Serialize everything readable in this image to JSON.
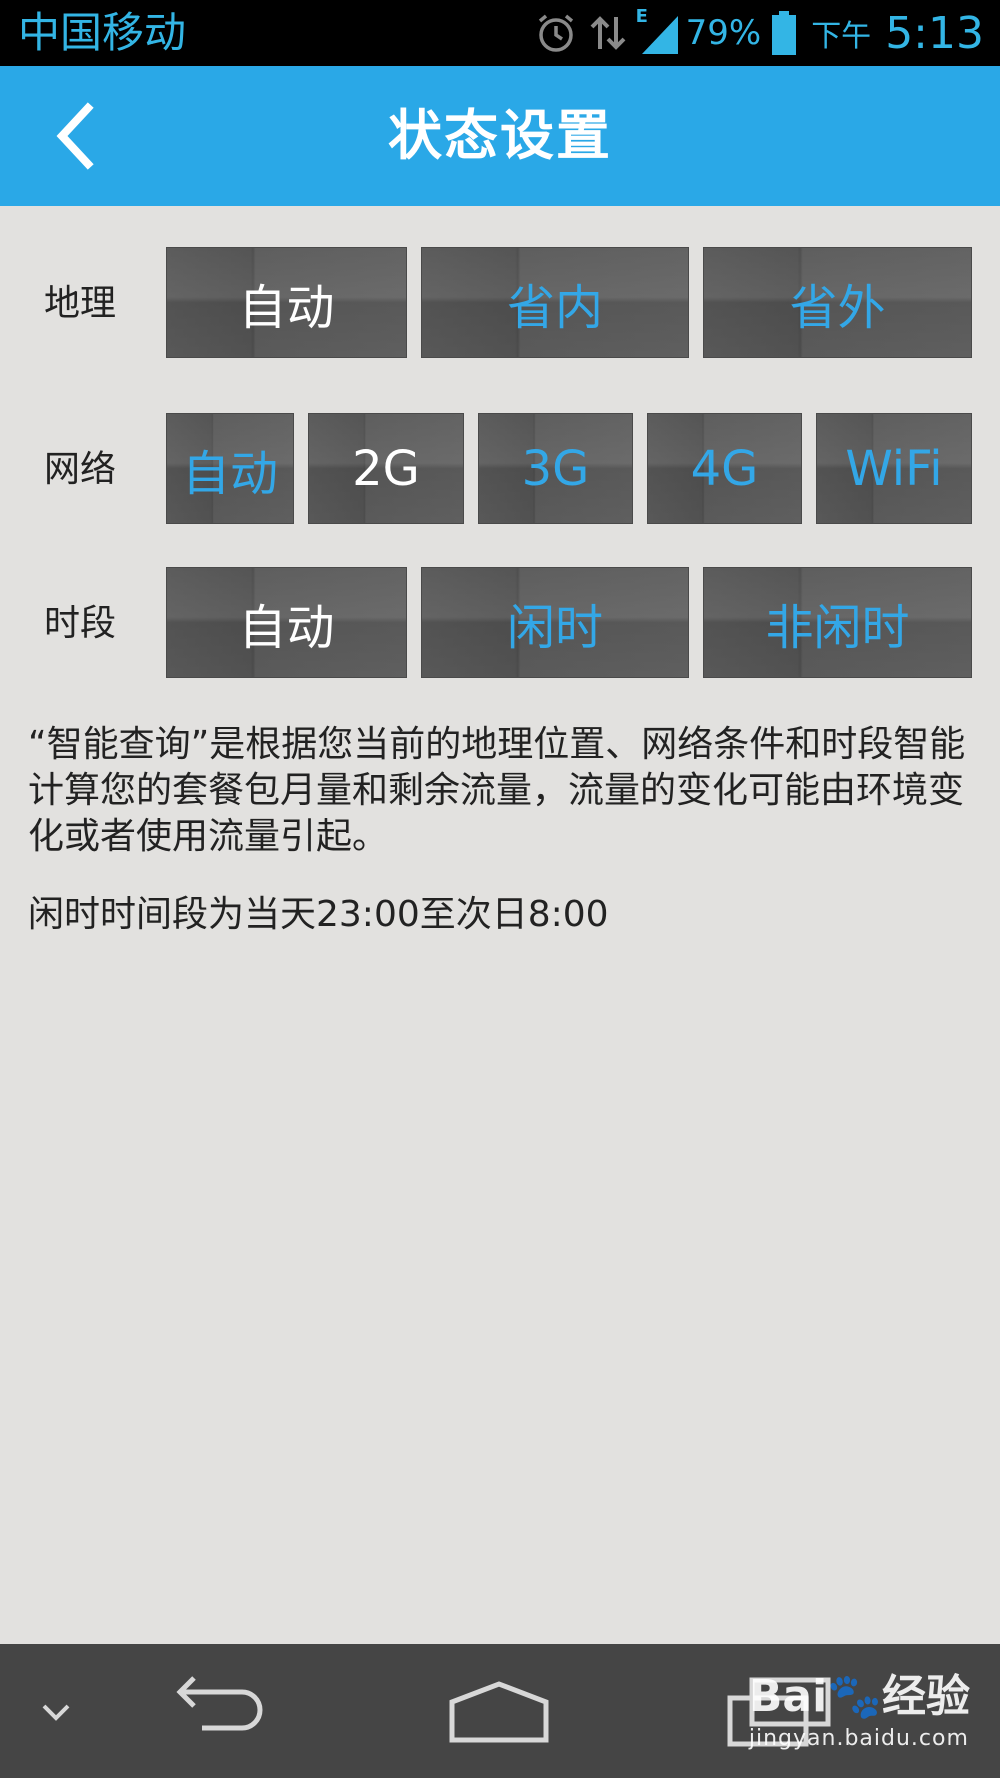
{
  "status_bar": {
    "carrier": "中国移动",
    "battery_percent": "79%",
    "ampm": "下午",
    "time": "5:13",
    "icons": [
      "alarm-icon",
      "data-arrows-icon",
      "signal-icon",
      "battery-icon"
    ],
    "network_badge": "E"
  },
  "header": {
    "title": "状态设置",
    "back_icon": "chevron-left-icon"
  },
  "rows": {
    "geo": {
      "label": "地理",
      "options": [
        "自动",
        "省内",
        "省外"
      ],
      "selected": "自动"
    },
    "network": {
      "label": "网络",
      "options": [
        "自动",
        "2G",
        "3G",
        "4G",
        "WiFi"
      ],
      "selected": "2G"
    },
    "period": {
      "label": "时段",
      "options": [
        "自动",
        "闲时",
        "非闲时"
      ],
      "selected": "自动"
    }
  },
  "description": "“智能查询”是根据您当前的地理位置、网络条件和时段智能计算您的套餐包月量和剩余流量，流量的变化可能由环境变化或者使用流量引起。",
  "idle_note": "闲时时间段为当天23:00至次日8:00",
  "nav_bar": {
    "icons": [
      "chevron-down-icon",
      "back-arrow-icon",
      "home-icon",
      "recent-apps-icon"
    ]
  },
  "watermark": {
    "logo": "Bai🐾经验",
    "url": "jingyan.baidu.com"
  },
  "colors": {
    "accent": "#2aa8e7",
    "option_text": "#33a7e7",
    "selected_text": "#ffffff",
    "background": "#e2e1df"
  }
}
